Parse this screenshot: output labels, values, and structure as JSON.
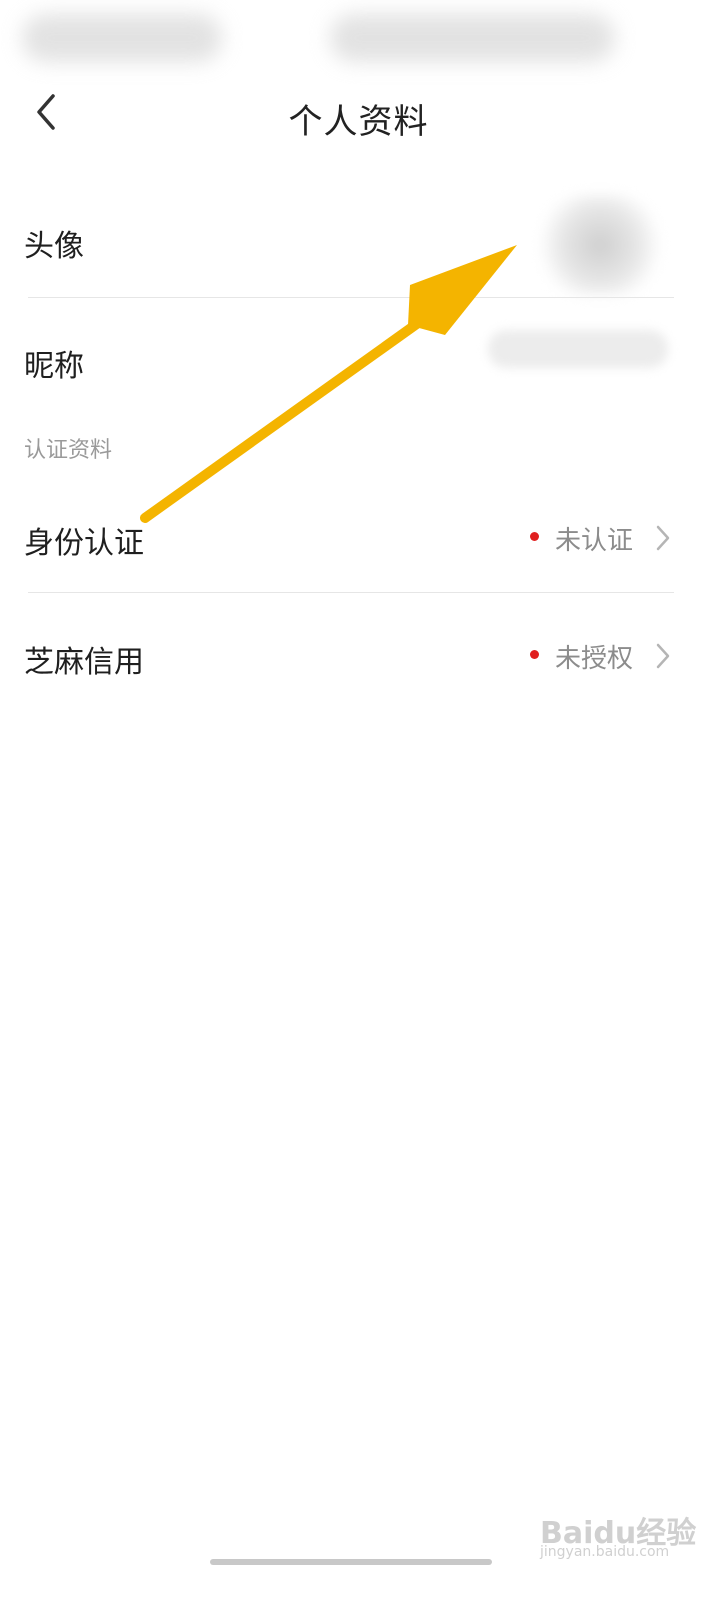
{
  "header": {
    "title": "个人资料"
  },
  "rows": {
    "avatar": {
      "label": "头像"
    },
    "nickname": {
      "label": "昵称"
    },
    "identity": {
      "label": "身份认证",
      "status": "未认证"
    },
    "sesame": {
      "label": "芝麻信用",
      "status": "未授权"
    }
  },
  "section": {
    "title": "认证资料"
  },
  "watermark": {
    "main": "Baidu经验",
    "sub": "jingyan.baidu.com"
  },
  "colors": {
    "accent_dot": "#e02020",
    "arrow": "#f4b400"
  },
  "icons": {
    "back": "chevron-left-icon",
    "row_arrow": "chevron-right-icon"
  }
}
